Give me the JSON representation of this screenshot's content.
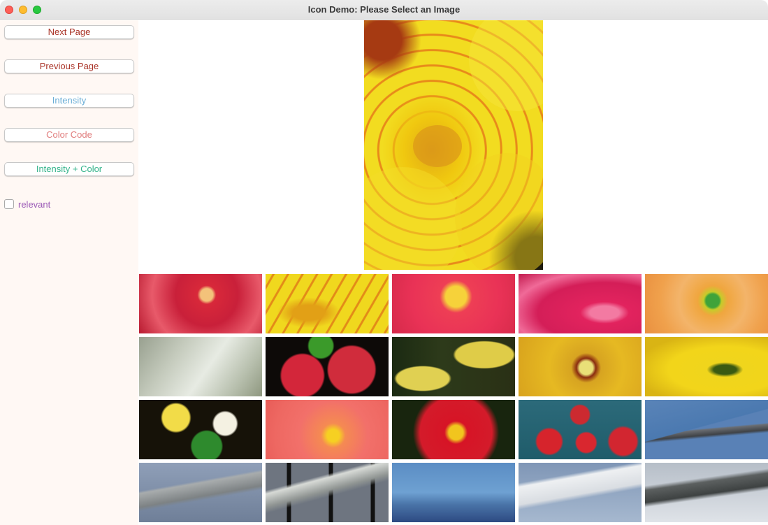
{
  "window": {
    "title": "Icon Demo: Please Select an Image"
  },
  "sidebar": {
    "buttons": [
      {
        "label": "Next Page",
        "color": "#a93226"
      },
      {
        "label": "Previous Page",
        "color": "#a93226"
      },
      {
        "label": "Intensity",
        "color": "#6aaed6"
      },
      {
        "label": "Color Code",
        "color": "#e07b7b"
      },
      {
        "label": "Intensity + Color",
        "color": "#33b38a"
      }
    ],
    "checkbox": {
      "label": "relevant",
      "checked": false,
      "color": "#9b59b6"
    }
  },
  "main_image": {
    "icon": "yellow-canna-flower-image"
  },
  "thumbnails": [
    {
      "icon": "red-hibiscus-image"
    },
    {
      "icon": "yellow-canna-image"
    },
    {
      "icon": "pink-flower-stamen-image"
    },
    {
      "icon": "pink-petals-image"
    },
    {
      "icon": "orange-gerbera-image"
    },
    {
      "icon": "white-flower-image"
    },
    {
      "icon": "radishes-image"
    },
    {
      "icon": "yellow-buds-image"
    },
    {
      "icon": "yellow-flower-stamen-image"
    },
    {
      "icon": "yellow-petals-image"
    },
    {
      "icon": "yellow-white-flowers-image"
    },
    {
      "icon": "coral-flower-image"
    },
    {
      "icon": "red-primrose-image"
    },
    {
      "icon": "strawberries-image"
    },
    {
      "icon": "jet-fighter-image"
    },
    {
      "icon": "p51-mustang-image"
    },
    {
      "icon": "p47-thunderbolt-image"
    },
    {
      "icon": "jet-takeoff-image"
    },
    {
      "icon": "snowbird-plane-image"
    },
    {
      "icon": "spitfire-image"
    }
  ]
}
